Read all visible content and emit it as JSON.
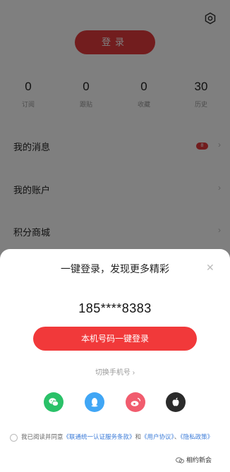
{
  "header": {
    "login_label": "登录",
    "settings_icon": "gear-icon"
  },
  "stats": [
    {
      "value": "0",
      "label": "订阅"
    },
    {
      "value": "0",
      "label": "跟贴"
    },
    {
      "value": "0",
      "label": "收藏"
    },
    {
      "value": "30",
      "label": "历史"
    }
  ],
  "menu": [
    {
      "label": "我的消息",
      "badge": "8"
    },
    {
      "label": "我的账户"
    },
    {
      "label": "积分商城"
    }
  ],
  "sheet": {
    "title": "一键登录，发现更多精彩",
    "close_icon": "close-icon",
    "phone": "185****8383",
    "onekey_label": "本机号码一键登录",
    "switch_label": "切换手机号 ›",
    "social": [
      "wechat-icon",
      "qq-icon",
      "weibo-icon",
      "apple-icon"
    ],
    "agreement": {
      "prefix": "我已阅读并同意",
      "link1": "《联通统一认证服务条款》",
      "mid": "和",
      "link2": "《用户协议》",
      "sep": "、",
      "link3": "《隐私政策》"
    }
  },
  "watermark": "相约新会",
  "colors": {
    "accent": "#f1393a",
    "wechat": "#2ac168",
    "qq": "#40a6f5",
    "weibo": "#f15c6e",
    "apple": "#2b2b2b"
  }
}
